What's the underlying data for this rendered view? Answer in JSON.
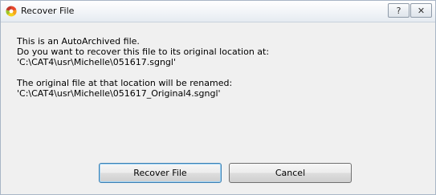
{
  "window": {
    "title": "Recover File",
    "help_glyph": "?",
    "close_glyph": "✕"
  },
  "message": {
    "line1": "This is an AutoArchived file.",
    "line2": "Do you want to recover this file to its original location at:",
    "line3": "'C:\\CAT4\\usr\\Michelle\\051617.sgngl'",
    "line4": "The original file at that location will be renamed:",
    "line5": "'C:\\CAT4\\usr\\Michelle\\051617_Original4.sgngl'"
  },
  "buttons": {
    "recover_label": "Recover File",
    "cancel_label": "Cancel"
  },
  "icons": {
    "app": "app-logo-icon",
    "help": "help-icon",
    "close": "close-icon"
  }
}
